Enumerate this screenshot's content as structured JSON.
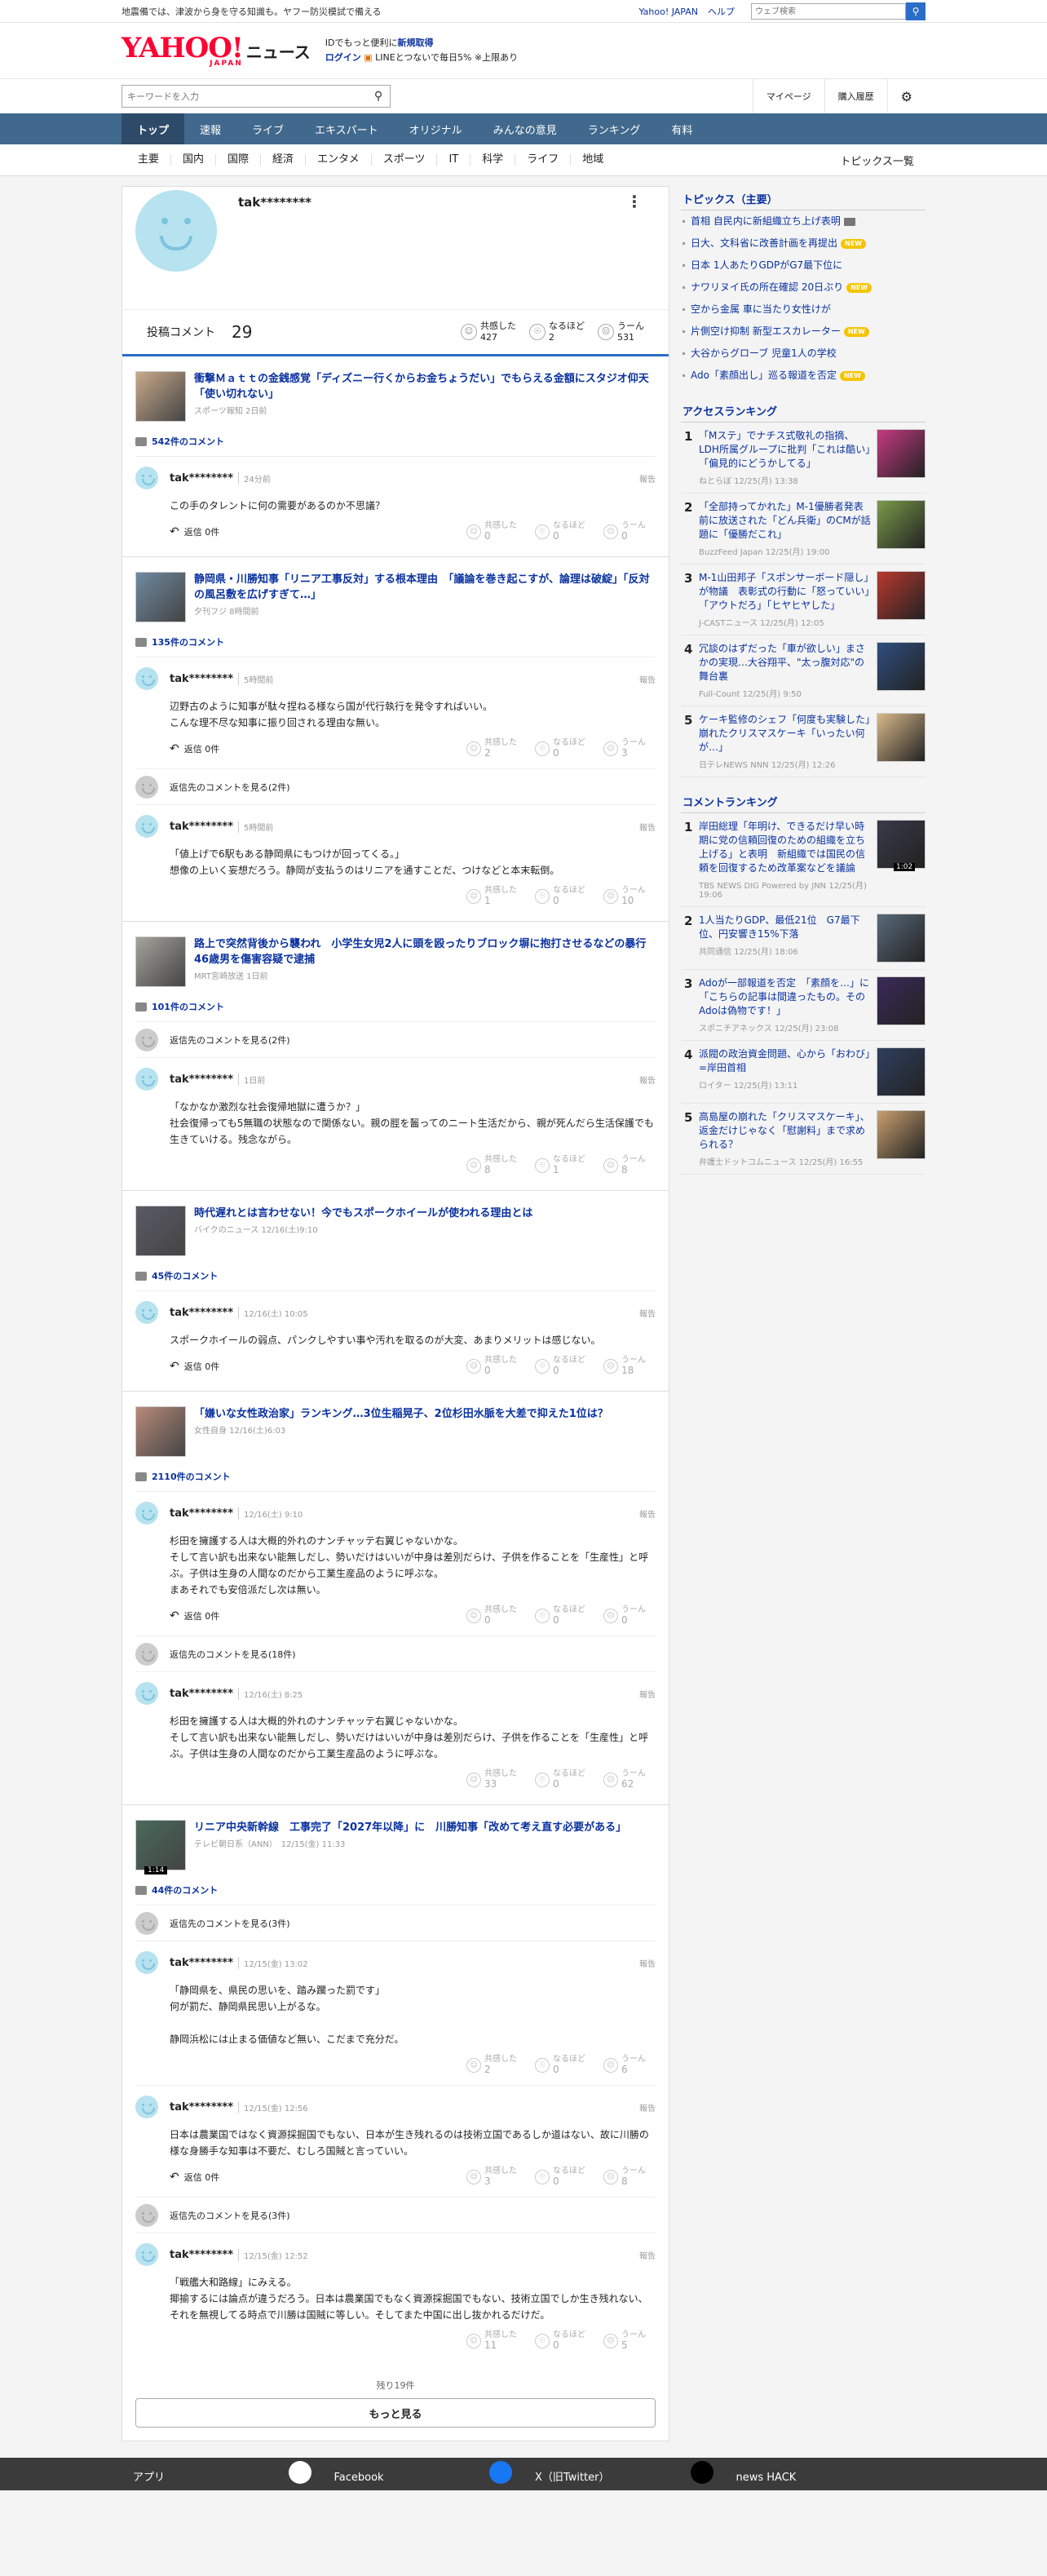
{
  "topbar": {
    "notice": "地震備では、津波から身を守る知識も。ヤフー防災模試で備える",
    "links": [
      "Yahoo! JAPAN",
      "ヘルプ"
    ],
    "search_placeholder": "ウェブ検索"
  },
  "masthead": {
    "logo": "YAHOO!",
    "logo_sub": "JAPAN",
    "service": "ニュース",
    "promo_line1": "IDでもっと便利に",
    "promo_link1": "新規取得",
    "promo_login": "ログイン",
    "promo_line2": "LINEとつないで毎日5% ※上限あり"
  },
  "searchbar": {
    "placeholder": "キーワードを入力",
    "links": [
      "マイページ",
      "購入履歴"
    ]
  },
  "nav": [
    "トップ",
    "速報",
    "ライブ",
    "エキスパート",
    "オリジナル",
    "みんなの意見",
    "ランキング",
    "有料"
  ],
  "subnav": [
    "主要",
    "国内",
    "国際",
    "経済",
    "エンタメ",
    "スポーツ",
    "IT",
    "科学",
    "ライフ",
    "地域"
  ],
  "subnav_all": "トピックス一覧",
  "profile": {
    "name": "tak********",
    "posted_label": "投稿コメント",
    "posted_count": "29",
    "reactions": [
      {
        "label": "共感した",
        "count": "427"
      },
      {
        "label": "なるほど",
        "count": "2"
      },
      {
        "label": "うーん",
        "count": "531"
      }
    ]
  },
  "reaction_labels": [
    "共感した",
    "なるほど",
    "うーん"
  ],
  "report_label": "報告",
  "reply_label": "返信 0件",
  "articles": [
    {
      "title": "衝撃Ｍａｔｔの金銭感覚「ディズニー行くからお金ちょうだい」でもらえる金額にスタジオ仰天「使い切れない」",
      "meta": "スポーツ報知 2日前",
      "count": "542件のコメント",
      "comments": [
        {
          "user": "tak********",
          "time": "24分前",
          "text": "この手のタレントに何の需要があるのか不思議？",
          "reply": true,
          "counts": [
            "0",
            "0",
            "0"
          ]
        }
      ]
    },
    {
      "title": "静岡県・川勝知事「リニア工事反対」する根本理由　「議論を巻き起こすが、論理は破綻」「反対の風呂敷を広げすぎて…」",
      "meta": "夕刊フジ 8時間前",
      "count": "135件のコメント",
      "comments": [
        {
          "user": "tak********",
          "time": "5時間前",
          "text": "辺野古のように知事が駄々捏ねる様なら国が代行執行を発令すればいい。\nこんな理不尽な知事に振り回される理由な無い。",
          "reply": true,
          "counts": [
            "2",
            "0",
            "3"
          ],
          "threads_after": "返信先のコメントを見る(2件)"
        },
        {
          "user": "tak********",
          "time": "5時間前",
          "text": "「値上げで6駅もある静岡県にもつけが回ってくる。」\n想像の上いく妄想だろう。静岡が支払うのはリニアを通すことだ、つけなどと本末転倒。",
          "reply": false,
          "counts": [
            "1",
            "0",
            "10"
          ]
        }
      ]
    },
    {
      "title": "路上で突然背後から襲われ　小学生女児2人に頭を殴ったりブロック塀に抱打させるなどの暴行　46歳男を傷害容疑で逮捕",
      "meta": "MRT宮崎放送 1日前",
      "count": "101件のコメント",
      "threads_before": "返信先のコメントを見る(2件)",
      "comments": [
        {
          "user": "tak********",
          "time": "1日前",
          "text": "「なかなか激烈な社会復帰地獄に遭うか？」\n社会復帰っても5無職の状態なので関係ない。親の脛を齧ってのニート生活だから、親が死んだら生活保護でも生きていける。残念ながら。",
          "reply": false,
          "counts": [
            "8",
            "1",
            "8"
          ]
        }
      ]
    },
    {
      "title": "時代遅れとは言わせない！今でもスポークホイールが使われる理由とは",
      "meta": "バイクのニュース 12/16(土)9:10",
      "count": "45件のコメント",
      "comments": [
        {
          "user": "tak********",
          "time": "12/16(土) 10:05",
          "text": "スポークホイールの弱点、パンクしやすい事や汚れを取るのが大変、あまりメリットは感じない。",
          "reply": true,
          "counts": [
            "0",
            "0",
            "18"
          ]
        }
      ]
    },
    {
      "title": "「嫌いな女性政治家」ランキング…3位生稲晃子、2位杉田水脈を大差で抑えた1位は？",
      "meta": "女性自身 12/16(土)6:03",
      "count": "2110件のコメント",
      "comments": [
        {
          "user": "tak********",
          "time": "12/16(土) 9:10",
          "text": "杉田を擁護する人は大概的外れのナンチャッテ右翼じゃないかな。\nそして言い訳も出来ない能無しだし、勢いだけはいいが中身は差別だらけ、子供を作ることを「生産性」と呼ぶ。子供は生身の人間なのだから工業生産品のように呼ぶな。\nまあそれでも安倍派だし次は無い。",
          "reply": true,
          "counts": [
            "0",
            "0",
            "0"
          ],
          "threads_after": "返信先のコメントを見る(18件)"
        },
        {
          "user": "tak********",
          "time": "12/16(土) 8:25",
          "text": "杉田を擁護する人は大概的外れのナンチャッテ右翼じゃないかな。\nそして言い訳も出来ない能無しだし、勢いだけはいいが中身は差別だらけ、子供を作ることを「生産性」と呼ぶ。子供は生身の人間なのだから工業生産品のように呼ぶな。",
          "reply": false,
          "counts": [
            "33",
            "0",
            "62"
          ]
        }
      ]
    },
    {
      "title": "リニア中央新幹線　工事完了「2027年以降」に　川勝知事「改めて考え直す必要がある」",
      "meta": "テレビ朝日系（ANN）　12/15(金) 11:33",
      "video": "1:14",
      "count": "44件のコメント",
      "threads_before": "返信先のコメントを見る(3件)",
      "comments": [
        {
          "user": "tak********",
          "time": "12/15(金) 13:02",
          "text": "「静岡県を、県民の思いを、踏み躙った罰です」\n何が罰だ、静岡県民思い上がるな。\n\n静岡浜松には止まる価値など無い、こだまで充分だ。",
          "reply": false,
          "counts": [
            "2",
            "0",
            "6"
          ]
        },
        {
          "user": "tak********",
          "time": "12/15(金) 12:56",
          "text": "日本は農業国ではなく資源採掘国でもない、日本が生き残れるのは技術立国であるしか道はない、故に川勝の様な身勝手な知事は不要だ、むしろ国賊と言っていい。",
          "reply": true,
          "counts": [
            "3",
            "0",
            "8"
          ],
          "threads_after": "返信先のコメントを見る(3件)"
        },
        {
          "user": "tak********",
          "time": "12/15(金) 12:52",
          "text": "「戦艦大和路線」にみえる。\n揶揄するには論点が違うだろう。日本は農業国でもなく資源採掘国でもない、技術立国でしか生き残れない、それを無視してる時点で川勝は国賊に等しい。そしてまた中国に出し抜かれるだけだ。",
          "reply": false,
          "counts": [
            "11",
            "0",
            "5"
          ]
        }
      ]
    }
  ],
  "more": {
    "remaining": "残り19件",
    "button": "もっと見る"
  },
  "topics": {
    "title": "トピックス（主要）",
    "items": [
      {
        "text": "首相 自民内に新組織立ち上げ表明",
        "tag": "cam"
      },
      {
        "text": "日大、文科省に改善計画を再提出",
        "tag": "NEW"
      },
      {
        "text": "日本 1人あたりGDPがG7最下位に",
        "tag": ""
      },
      {
        "text": "ナワリヌイ氏の所在確認 20日ぶり",
        "tag": "NEW"
      },
      {
        "text": "空から金属 車に当たり女性けが",
        "tag": ""
      },
      {
        "text": "片側空け抑制 新型エスカレーター",
        "tag": "NEW"
      },
      {
        "text": "大谷からグローブ 児童1人の学校",
        "tag": ""
      },
      {
        "text": "Ado「素顔出し」巡る報道を否定",
        "tag": "NEW"
      }
    ]
  },
  "access_ranking": {
    "title": "アクセスランキング",
    "items": [
      {
        "num": "1",
        "text": "「Mステ」でナチス式敬礼の指摘、LDH所属グループに批判「これは酷い」「偏見的にどうかしてる」",
        "meta": "ねとらぼ 12/25(月) 13:38",
        "color": "#c63a82"
      },
      {
        "num": "2",
        "text": "「全部持ってかれた」M-1優勝者発表前に放送された「どん兵衛」のCMが話題に「優勝だこれ」",
        "meta": "BuzzFeed Japan 12/25(月) 19:00",
        "color": "#7a9b4a"
      },
      {
        "num": "3",
        "text": "M-1山田邦子「スポンサーボード隠し」が物議　表彰式の行動に「怒っていい」「アウトだろ」「ヒヤヒヤした」",
        "meta": "J-CASTニュース 12/25(月) 12:05",
        "color": "#b8392f"
      },
      {
        "num": "4",
        "text": "冗談のはずだった「車が欲しい」まさかの実現…大谷翔平、\"太っ腹対応\"の舞台裏",
        "meta": "Full-Count 12/25(月) 9:50",
        "color": "#2f4f7f"
      },
      {
        "num": "5",
        "text": "ケーキ監修のシェフ「何度も実験した」　崩れたクリスマスケーキ「いったい何が…」",
        "meta": "日テレNEWS NNN 12/25(月) 12:26",
        "color": "#d9b98a"
      }
    ]
  },
  "comment_ranking": {
    "title": "コメントランキング",
    "items": [
      {
        "num": "1",
        "text": "岸田総理「年明け、できるだけ早い時期に党の信頼回復のための組織を立ち上げる」と表明　新組織では国民の信頼を回復するため改革案などを議論",
        "meta": "TBS NEWS DIG Powered by JNN 12/25(月) 19:06",
        "video": "1:02",
        "color": "#3a3a4a"
      },
      {
        "num": "2",
        "text": "1人当たりGDP、最低21位　G7最下位、円安響き15%下落",
        "meta": "共同通信 12/25(月) 18:06",
        "color": "#5a6a7a"
      },
      {
        "num": "3",
        "text": "Adoが一部報道を否定　「素顔を…」に「こちらの記事は間違ったもの。そのAdoは偽物です！」",
        "meta": "スポニチアネックス 12/25(月) 23:08",
        "color": "#3b2a5a"
      },
      {
        "num": "4",
        "text": "派閥の政治資金問題、心から「おわび」=岸田首相",
        "meta": "ロイター 12/25(月) 13:11",
        "color": "#2f3f5f"
      },
      {
        "num": "5",
        "text": "高島屋の崩れた「クリスマスケーキ」、返金だけじゃなく「慰謝料」まで求められる？",
        "meta": "弁護士ドットコムニュース 12/25(月) 16:55",
        "color": "#c9a070"
      }
    ]
  },
  "footer": [
    "アプリ",
    "Facebook",
    "X（旧Twitter）",
    "news HACK"
  ]
}
